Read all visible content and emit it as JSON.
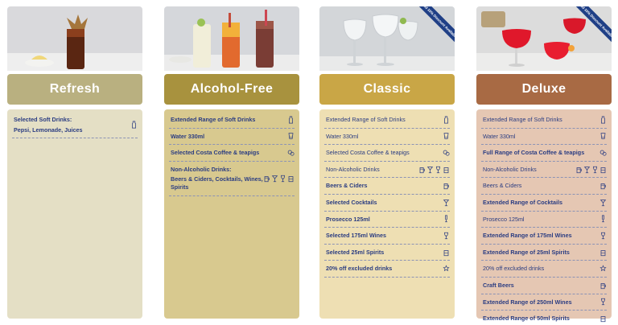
{
  "columns": [
    {
      "title": "Refresh",
      "header_color": "#b9b080",
      "panel_color": "#e4dfc5",
      "badge": "",
      "rows": [
        {
          "label": "Selected Soft Drinks:",
          "sub": "Pepsi, Lemonade, Juices",
          "bold": true,
          "icons": [
            "bottle-icon"
          ]
        }
      ]
    },
    {
      "title": "Alcohol-Free",
      "header_color": "#a8923e",
      "panel_color": "#d8c98f",
      "badge": "",
      "rows": [
        {
          "label": "Extended Range of Soft Drinks",
          "bold": true,
          "icons": [
            "bottle-icon"
          ]
        },
        {
          "label": "Water 330ml",
          "bold": true,
          "icons": [
            "glass-icon"
          ]
        },
        {
          "label": "Selected Costa Coffee & teapigs",
          "bold": true,
          "icons": [
            "coffee-icon"
          ]
        },
        {
          "label": "Non-Alcoholic Drinks:",
          "sub": "Beers & Ciders, Cocktails, Wines, Spirits",
          "bold": true,
          "icons": [
            "beer-icon",
            "cocktail-icon",
            "wine-icon",
            "spirit-icon"
          ]
        }
      ]
    },
    {
      "title": "Classic",
      "header_color": "#c9a646",
      "panel_color": "#eedfb3",
      "badge": "Add 10% Discount Available",
      "rows": [
        {
          "label": "Extended Range of Soft Drinks",
          "bold": false,
          "icons": [
            "bottle-icon"
          ]
        },
        {
          "label": "Water 330ml",
          "bold": false,
          "icons": [
            "glass-icon"
          ]
        },
        {
          "label": "Selected Costa Coffee & teapigs",
          "bold": false,
          "icons": [
            "coffee-icon"
          ]
        },
        {
          "label": "Non-Alcoholic Drinks",
          "bold": false,
          "icons": [
            "beer-icon",
            "cocktail-icon",
            "wine-icon",
            "spirit-icon"
          ]
        },
        {
          "label": "Beers & Ciders",
          "bold": true,
          "icons": [
            "beer-icon"
          ]
        },
        {
          "label": "Selected Cocktails",
          "bold": true,
          "icons": [
            "cocktail-icon"
          ]
        },
        {
          "label": "Prosecco 125ml",
          "bold": true,
          "icons": [
            "prosecco-icon"
          ]
        },
        {
          "label": "Selected 175ml Wines",
          "bold": true,
          "icons": [
            "wine-icon"
          ]
        },
        {
          "label": "Selected 25ml Spirits",
          "bold": true,
          "icons": [
            "spirit-icon"
          ]
        },
        {
          "label": "20% off excluded drinks",
          "bold": true,
          "icons": [
            "star-icon"
          ]
        }
      ]
    },
    {
      "title": "Deluxe",
      "header_color": "#a86a44",
      "panel_color": "#e5c7b3",
      "badge": "Add 10% Discount Available",
      "rows": [
        {
          "label": "Extended Range of Soft Drinks",
          "bold": false,
          "icons": [
            "bottle-icon"
          ]
        },
        {
          "label": "Water 330ml",
          "bold": false,
          "icons": [
            "glass-icon"
          ]
        },
        {
          "label": "Full Range of Costa Coffee & teapigs",
          "bold": true,
          "icons": [
            "coffee-icon"
          ]
        },
        {
          "label": "Non-Alcoholic Drinks",
          "bold": false,
          "icons": [
            "beer-icon",
            "cocktail-icon",
            "wine-icon",
            "spirit-icon"
          ]
        },
        {
          "label": "Beers & Ciders",
          "bold": false,
          "icons": [
            "beer-icon"
          ]
        },
        {
          "label": "Extended Range of Cocktails",
          "bold": true,
          "icons": [
            "cocktail-icon"
          ]
        },
        {
          "label": "Prosecco 125ml",
          "bold": false,
          "icons": [
            "prosecco-icon"
          ]
        },
        {
          "label": "Extended Range of 175ml Wines",
          "bold": true,
          "icons": [
            "wine-icon"
          ]
        },
        {
          "label": "Extended Range of 25ml Spirits",
          "bold": true,
          "icons": [
            "spirit-icon"
          ]
        },
        {
          "label": "20% off excluded drinks",
          "bold": false,
          "icons": [
            "star-icon"
          ]
        },
        {
          "label": "Craft Beers",
          "bold": true,
          "icons": [
            "beer-icon"
          ]
        },
        {
          "label": "Extended Range of 250ml Wines",
          "bold": true,
          "icons": [
            "wine-icon"
          ]
        },
        {
          "label": "Extended Range of 50ml Spirits",
          "bold": true,
          "icons": [
            "spirit-icon"
          ]
        }
      ]
    }
  ]
}
